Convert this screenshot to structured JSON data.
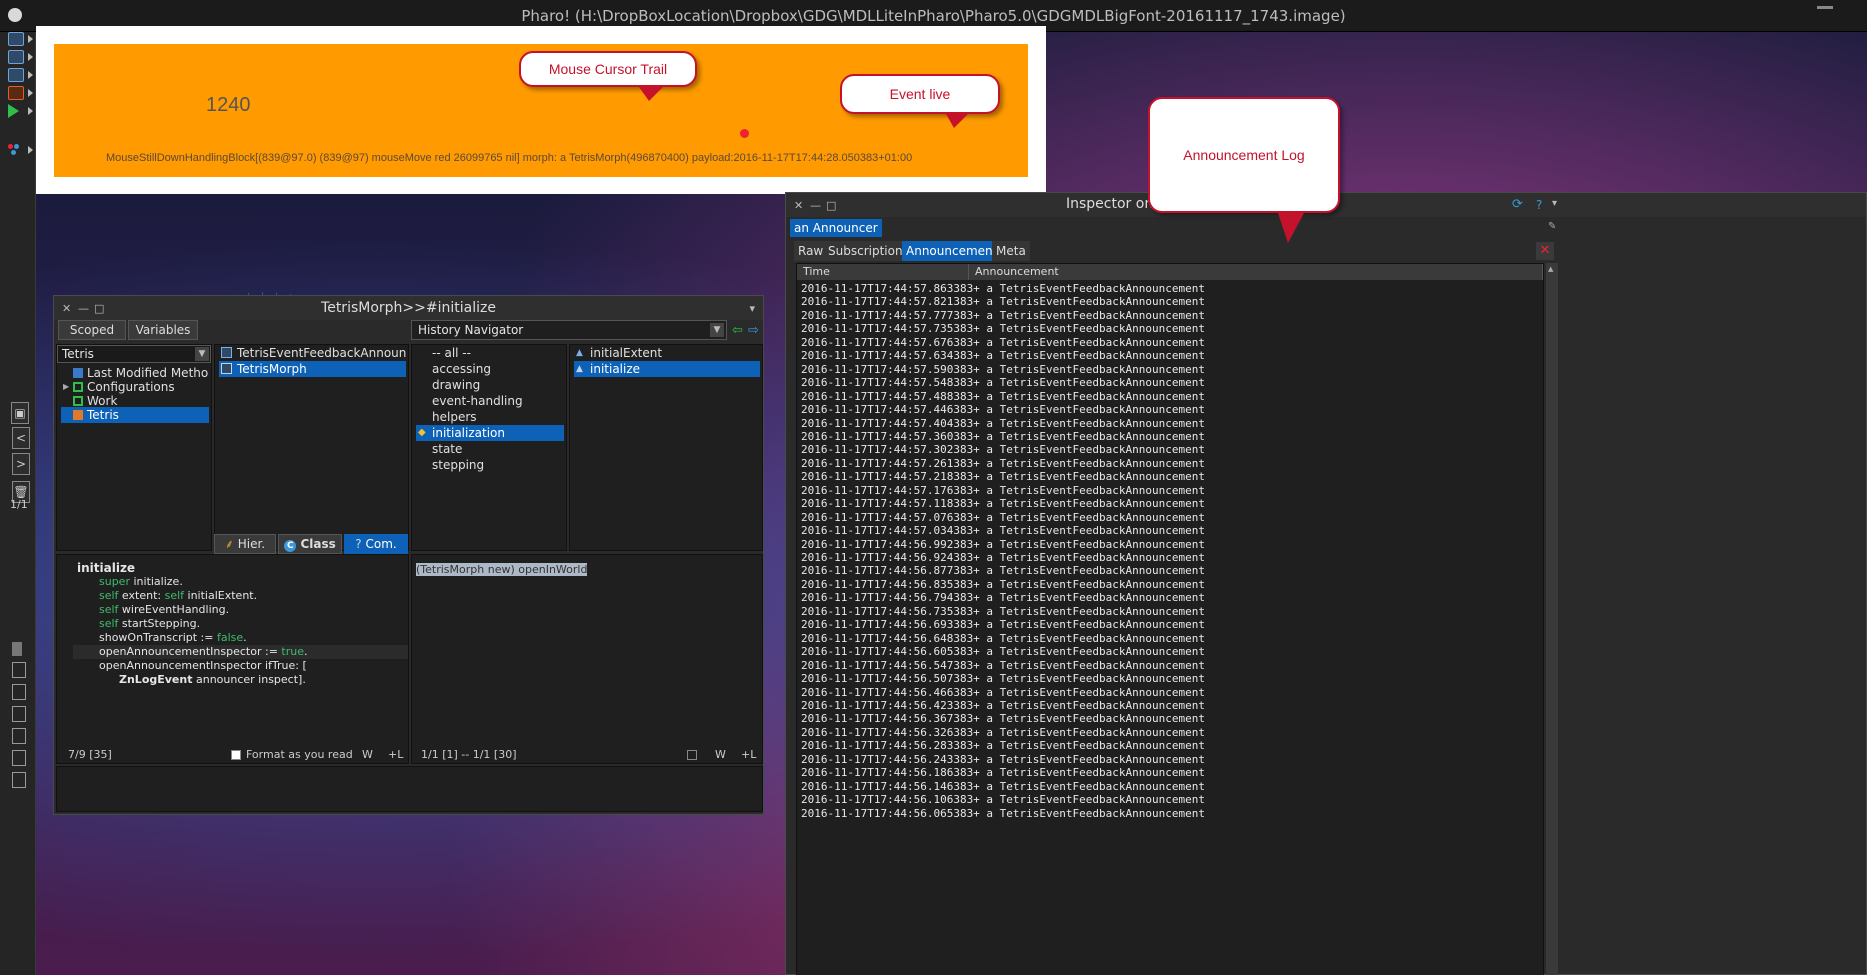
{
  "window": {
    "title": "Pharo! (H:\\DropBoxLocation\\Dropbox\\GDG\\MDLLiteInPharo\\Pharo5.0\\GDGMDLBigFont-20161117_1743.image)"
  },
  "event_panel": {
    "counter": "1240",
    "event_text": "MouseStillDownHandlingBlock[(839@97.0) (839@97) mouseMove red 26099765 nil] morph: a TetrisMorph(496870400) payload:2016-11-17T17:44:28.050383+01:00"
  },
  "callouts": {
    "cursor_trail": "Mouse Cursor Trail",
    "event_live": "Event live",
    "announcement_log": "Announcement Log"
  },
  "taskbar": {
    "page_counter": "1/1",
    "prev_label": "<",
    "next_label": ">"
  },
  "browser": {
    "title": "TetrisMorph>>#initialize",
    "scoped_label": "Scoped",
    "variables_label": "Variables",
    "history_label": "History Navigator",
    "package_filter": "Tetris",
    "packages": [
      "Last Modified Methods",
      "Configurations",
      "Work",
      "Tetris"
    ],
    "classes": [
      "TetrisEventFeedbackAnnouncement",
      "TetrisMorph"
    ],
    "protocols": [
      "-- all --",
      "accessing",
      "drawing",
      "event-handling",
      "helpers",
      "initialization",
      "state",
      "stepping"
    ],
    "methods": [
      "initialExtent",
      "initialize"
    ],
    "hier_label": "Hier.",
    "class_label": "Class",
    "com_label": "Com.",
    "code": {
      "selector": "initialize",
      "line1_kw": "super",
      "line1_rest": " initialize.",
      "line2_kw": "self",
      "line2_a": " extent: ",
      "line2_kw2": "self",
      "line2_b": " initialExtent.",
      "line3_kw": "self",
      "line3_rest": " wireEventHandling.",
      "line4_kw": "self",
      "line4_rest": " startStepping.",
      "line5_a": "showOnTranscript := ",
      "line5_kw": "false",
      "line5_b": ".",
      "line6_a": "openAnnouncementInspector := ",
      "line6_kw": "true",
      "line6_b": ".",
      "line7": "openAnnouncementInspector ifTrue: [",
      "line8_bold": "ZnLogEvent",
      "line8_rest": " announcer inspect]."
    },
    "code_status": "7/9 [35]",
    "format_label": "Format as you read",
    "w_label": "W",
    "l_label": "+L",
    "playground_text": "(TetrisMorph new) openInWorld",
    "playground_status": "1/1 [1] -- 1/1 [30]"
  },
  "inspector": {
    "title": "Inspector on a",
    "object_label": "an Announcer",
    "tabs": [
      "Raw",
      "Subscriptions",
      "Announcements",
      "Meta"
    ],
    "columns": [
      "Time",
      "Announcement"
    ],
    "rows": [
      "2016-11-17T17:44:57.863383+ a TetrisEventFeedbackAnnouncement",
      "2016-11-17T17:44:57.821383+ a TetrisEventFeedbackAnnouncement",
      "2016-11-17T17:44:57.777383+ a TetrisEventFeedbackAnnouncement",
      "2016-11-17T17:44:57.735383+ a TetrisEventFeedbackAnnouncement",
      "2016-11-17T17:44:57.676383+ a TetrisEventFeedbackAnnouncement",
      "2016-11-17T17:44:57.634383+ a TetrisEventFeedbackAnnouncement",
      "2016-11-17T17:44:57.590383+ a TetrisEventFeedbackAnnouncement",
      "2016-11-17T17:44:57.548383+ a TetrisEventFeedbackAnnouncement",
      "2016-11-17T17:44:57.488383+ a TetrisEventFeedbackAnnouncement",
      "2016-11-17T17:44:57.446383+ a TetrisEventFeedbackAnnouncement",
      "2016-11-17T17:44:57.404383+ a TetrisEventFeedbackAnnouncement",
      "2016-11-17T17:44:57.360383+ a TetrisEventFeedbackAnnouncement",
      "2016-11-17T17:44:57.302383+ a TetrisEventFeedbackAnnouncement",
      "2016-11-17T17:44:57.261383+ a TetrisEventFeedbackAnnouncement",
      "2016-11-17T17:44:57.218383+ a TetrisEventFeedbackAnnouncement",
      "2016-11-17T17:44:57.176383+ a TetrisEventFeedbackAnnouncement",
      "2016-11-17T17:44:57.118383+ a TetrisEventFeedbackAnnouncement",
      "2016-11-17T17:44:57.076383+ a TetrisEventFeedbackAnnouncement",
      "2016-11-17T17:44:57.034383+ a TetrisEventFeedbackAnnouncement",
      "2016-11-17T17:44:56.992383+ a TetrisEventFeedbackAnnouncement",
      "2016-11-17T17:44:56.924383+ a TetrisEventFeedbackAnnouncement",
      "2016-11-17T17:44:56.877383+ a TetrisEventFeedbackAnnouncement",
      "2016-11-17T17:44:56.835383+ a TetrisEventFeedbackAnnouncement",
      "2016-11-17T17:44:56.794383+ a TetrisEventFeedbackAnnouncement",
      "2016-11-17T17:44:56.735383+ a TetrisEventFeedbackAnnouncement",
      "2016-11-17T17:44:56.693383+ a TetrisEventFeedbackAnnouncement",
      "2016-11-17T17:44:56.648383+ a TetrisEventFeedbackAnnouncement",
      "2016-11-17T17:44:56.605383+ a TetrisEventFeedbackAnnouncement",
      "2016-11-17T17:44:56.547383+ a TetrisEventFeedbackAnnouncement",
      "2016-11-17T17:44:56.507383+ a TetrisEventFeedbackAnnouncement",
      "2016-11-17T17:44:56.466383+ a TetrisEventFeedbackAnnouncement",
      "2016-11-17T17:44:56.423383+ a TetrisEventFeedbackAnnouncement",
      "2016-11-17T17:44:56.367383+ a TetrisEventFeedbackAnnouncement",
      "2016-11-17T17:44:56.326383+ a TetrisEventFeedbackAnnouncement",
      "2016-11-17T17:44:56.283383+ a TetrisEventFeedbackAnnouncement",
      "2016-11-17T17:44:56.243383+ a TetrisEventFeedbackAnnouncement",
      "2016-11-17T17:44:56.186383+ a TetrisEventFeedbackAnnouncement",
      "2016-11-17T17:44:56.146383+ a TetrisEventFeedbackAnnouncement",
      "2016-11-17T17:44:56.106383+ a TetrisEventFeedbackAnnouncement",
      "2016-11-17T17:44:56.065383+ a TetrisEventFeedbackAnnouncement"
    ]
  },
  "colors": {
    "accent": "#0d62b8",
    "event_panel": "#ff9a00",
    "callout_border": "#c4122a",
    "keyword": "#3dbc6b"
  }
}
